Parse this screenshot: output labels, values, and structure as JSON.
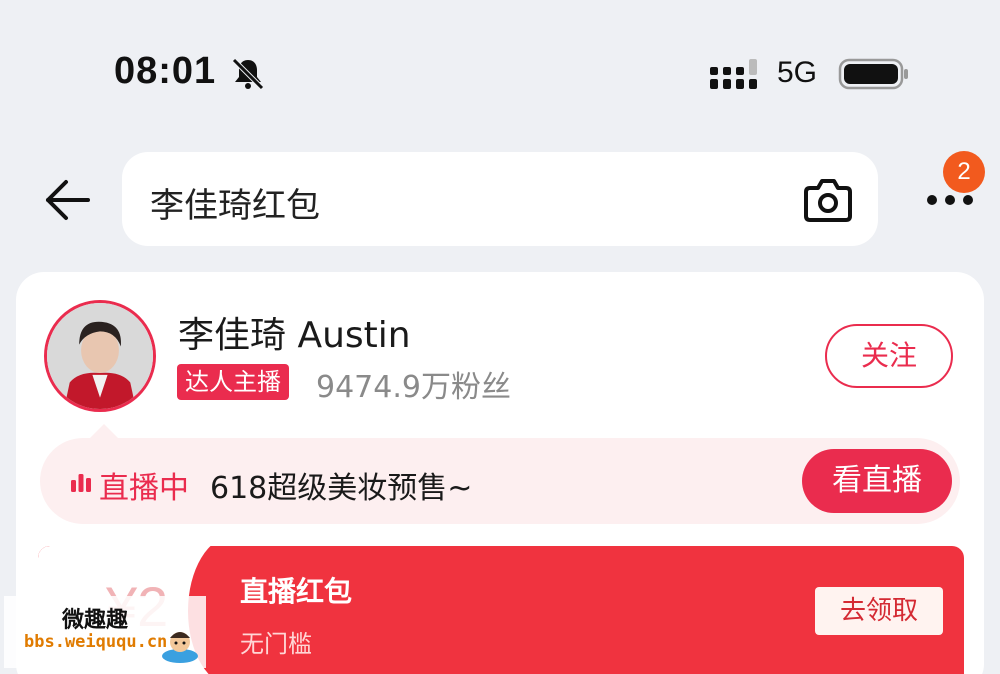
{
  "status_bar": {
    "time": "08:01",
    "network": "5G",
    "icons": [
      "bell-muted-icon",
      "signal-icon",
      "battery-icon"
    ]
  },
  "header": {
    "search_query": "李佳琦红包",
    "more_badge_count": "2",
    "icons": [
      "back-arrow-icon",
      "camera-icon",
      "more-icon"
    ]
  },
  "streamer": {
    "name": "李佳琦 Austin",
    "role_tag": "达人主播",
    "fans": "9474.9万粉丝",
    "follow_label": "关注"
  },
  "live": {
    "status": "直播中",
    "title": "618超级美妆预售~",
    "watch_label": "看直播"
  },
  "red_packet": {
    "amount": "¥2",
    "title": "直播红包",
    "subtitle": "无门槛",
    "claim_label": "去领取"
  },
  "watermark": {
    "title": "微趣趣",
    "url": "bbs.weiququ.cn"
  },
  "colors": {
    "accent": "#ea2c4e",
    "packet_red": "#f0333f",
    "badge_orange": "#f25a1e",
    "background": "#eef0f4"
  }
}
